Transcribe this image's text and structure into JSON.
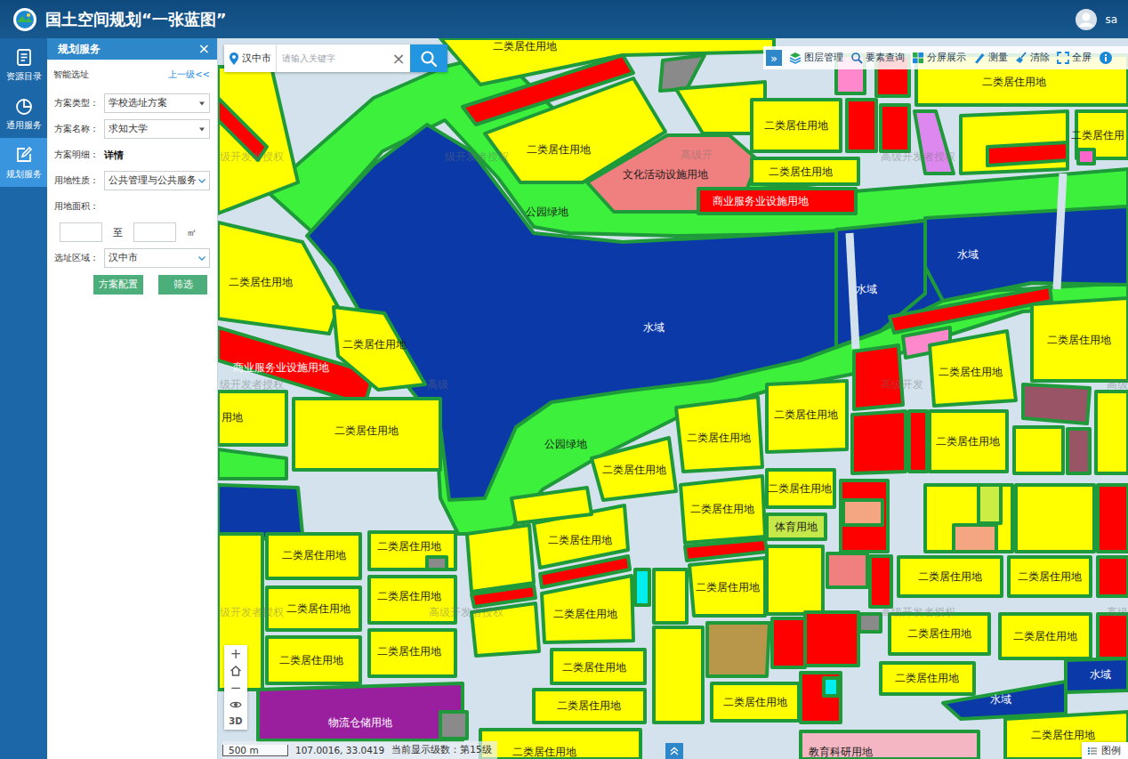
{
  "header": {
    "title": "国土空间规划“一张蓝图”",
    "user": "sa"
  },
  "nav": [
    {
      "label": "资源目录",
      "selected": false
    },
    {
      "label": "通用服务",
      "selected": false
    },
    {
      "label": "规划服务",
      "selected": true
    }
  ],
  "panel": {
    "title": "规划服务",
    "close": "×",
    "subtitle": "智能选址",
    "back": "上一级<<",
    "fields": [
      {
        "label": "方案类型：",
        "value": "学校选址方案",
        "kind": "select"
      },
      {
        "label": "方案名称：",
        "value": "求知大学",
        "kind": "select"
      },
      {
        "label": "方案明细：",
        "value": "详情",
        "kind": "link"
      },
      {
        "label": "用地性质：",
        "value": "公共管理与公共服务",
        "kind": "dropdown"
      }
    ],
    "area": {
      "label": "用地面积：",
      "from": "",
      "to": "",
      "separator": "至",
      "unit": "㎡"
    },
    "region": {
      "label": "选址区域：",
      "value": "汉中市",
      "kind": "dropdown"
    },
    "buttons": [
      "方案配置",
      "筛选"
    ]
  },
  "search": {
    "city": "汉中市",
    "placeholder": "请输入关键字",
    "clear": "×"
  },
  "toolbar": {
    "toggle": "»",
    "tools": [
      "图层管理",
      "要素查询",
      "分屏展示",
      "测量",
      "清除",
      "全屏"
    ]
  },
  "zoom": {
    "zoom_in": "+",
    "zoom_out": "−",
    "mode": "3D"
  },
  "status": {
    "scale": "500 m",
    "coords": "107.0016, 33.0419",
    "level": "当前显示级数：第15级"
  },
  "legend": "图例",
  "watermarks": [
    "级开发者授权",
    "级开发者授权",
    "高级开",
    "高级开发者授权",
    "级开发者授权",
    "高级",
    "高级开发",
    "高级",
    "级开发者授权",
    "高级开发者授权",
    "高级开发者授权",
    "高级"
  ],
  "parcels": [
    {
      "label": "公园绿地",
      "color": "#3cf03c"
    },
    {
      "label": "公园绿地",
      "color": "#3cf03c"
    },
    {
      "label": "水域",
      "color": "#0b3aa8"
    },
    {
      "label": "水域",
      "color": "#0b3aa8"
    },
    {
      "label": "水域",
      "color": "#0b3aa8"
    },
    {
      "label": "",
      "color": "#0b3aa8"
    },
    {
      "label": "",
      "color": "#ffff00"
    },
    {
      "label": "",
      "color": "#ff0000"
    },
    {
      "label": "二类居住用地",
      "color": "#ffff00"
    },
    {
      "label": "商业服务业设施用地",
      "color": "#ff0000"
    },
    {
      "label": "二类居住用地",
      "color": "#ffff00"
    },
    {
      "label": "二类居住用地",
      "color": "#ffff00"
    },
    {
      "label": "用地",
      "color": "#ffff00"
    },
    {
      "label": "",
      "color": "#3cf03c"
    },
    {
      "label": "",
      "color": "#ffff00"
    },
    {
      "label": "二类居住用地",
      "color": "#ffff00"
    },
    {
      "label": "二类居住用地",
      "color": "#ffff00"
    },
    {
      "label": "",
      "color": "#8a8a8a"
    },
    {
      "label": "二类居住用地",
      "color": "#ffff00"
    },
    {
      "label": "二类居住用地",
      "color": "#ffff00"
    },
    {
      "label": "二类居住用地",
      "color": "#ffff00"
    },
    {
      "label": "二类居住用地",
      "color": "#ffff00"
    },
    {
      "label": "物流仓储用地",
      "color": "#9a1f9e"
    },
    {
      "label": "",
      "color": "#8a8a8a"
    },
    {
      "label": "",
      "color": "#ffff00"
    },
    {
      "label": "",
      "color": "#ff0000"
    },
    {
      "label": "",
      "color": "#ffff00"
    },
    {
      "label": "二类居住用地",
      "color": "#ffff00"
    },
    {
      "label": "",
      "color": "#ff0000"
    },
    {
      "label": "二类居住用地",
      "color": "#ffff00"
    },
    {
      "label": "二类居住用地",
      "color": "#ffff00"
    },
    {
      "label": "二类居住用地",
      "color": "#ffff00"
    },
    {
      "label": "",
      "color": "#ffff00"
    },
    {
      "label": "二类居住用地",
      "color": "#ffff00"
    },
    {
      "label": "",
      "color": "#00eeee"
    },
    {
      "label": "",
      "color": "#ffff00"
    },
    {
      "label": "二类居住用地",
      "color": "#ffff00"
    },
    {
      "label": "二类居住用地",
      "color": "#ffff00"
    },
    {
      "label": "",
      "color": "#ff0000"
    },
    {
      "label": "二类居住用地",
      "color": "#ffff00"
    },
    {
      "label": "二类居住用地",
      "color": "#ffff00"
    },
    {
      "label": "二类居住用地",
      "color": "#ffff00"
    },
    {
      "label": "体育用地",
      "color": "#c5e84a"
    },
    {
      "label": "",
      "color": "#ffff00"
    },
    {
      "label": "",
      "color": "#b8964a"
    },
    {
      "label": "",
      "color": "#ff0000"
    },
    {
      "label": "二类居住用地",
      "color": "#ffff00"
    },
    {
      "label": "",
      "color": "#ffff00"
    },
    {
      "label": "",
      "color": "#ff0000"
    },
    {
      "label": "",
      "color": "#ff0000"
    },
    {
      "label": "",
      "color": "#ff0000"
    },
    {
      "label": "",
      "color": "#ff0000"
    },
    {
      "label": "",
      "color": "#f4a582"
    },
    {
      "label": "",
      "color": "#f08080"
    },
    {
      "label": "",
      "color": "#ff0000"
    },
    {
      "label": "",
      "color": "#ff0000"
    },
    {
      "label": "",
      "color": "#8a8a8a"
    },
    {
      "label": "",
      "color": "#ff0000"
    },
    {
      "label": "",
      "color": "#00eeee"
    },
    {
      "label": "",
      "color": "#ff88cc"
    },
    {
      "label": "二类居住用地",
      "color": "#ffff00"
    },
    {
      "label": "",
      "color": "#ff0000"
    },
    {
      "label": "二类居住用地",
      "color": "#ffff00"
    },
    {
      "label": "",
      "color": "#995566"
    },
    {
      "label": "二类居住用地",
      "color": "#ffff00"
    },
    {
      "label": "",
      "color": "#ffff00"
    },
    {
      "label": "",
      "color": "#995566"
    },
    {
      "label": "",
      "color": "#ffff00"
    },
    {
      "label": "",
      "color": "#ffff00"
    },
    {
      "label": "",
      "color": "#ccee44"
    },
    {
      "label": "",
      "color": "#f4a582"
    },
    {
      "label": "",
      "color": "#ffff00"
    },
    {
      "label": "",
      "color": "#ff0000"
    },
    {
      "label": "二类居住用地",
      "color": "#ffff00"
    },
    {
      "label": "二类居住用地",
      "color": "#ffff00"
    },
    {
      "label": "",
      "color": "#ff0000"
    },
    {
      "label": "二类居住用地",
      "color": "#ffff00"
    },
    {
      "label": "二类居住用地",
      "color": "#ffff00"
    },
    {
      "label": "",
      "color": "#ff0000"
    },
    {
      "label": "二类居住用地",
      "color": "#ffff00"
    },
    {
      "label": "水域",
      "color": "#0b3aa8"
    },
    {
      "label": "水域",
      "color": "#0b3aa8"
    },
    {
      "label": "二类居住用地",
      "color": "#ffff00"
    },
    {
      "label": "教育科研用地",
      "color": "#f4b6c2"
    },
    {
      "label": "二类居住用地",
      "color": "#ffff00"
    },
    {
      "label": "二类居住用地",
      "color": "#ffff00"
    },
    {
      "label": "",
      "color": "#ff0000"
    },
    {
      "label": "二类居住用地",
      "color": "#ffff00"
    },
    {
      "label": "",
      "color": "#8a8a8a"
    },
    {
      "label": "",
      "color": "#ffff00"
    },
    {
      "label": "文化活动设施用地",
      "color": "#f08080"
    },
    {
      "label": "二类居住用地",
      "color": "#ffff00"
    },
    {
      "label": "",
      "color": "#ff0000"
    },
    {
      "label": "二类居住用地",
      "color": "#ffff00"
    },
    {
      "label": "商业服务业设施用地",
      "color": "#ff0000"
    },
    {
      "label": "",
      "color": "#ff88cc"
    },
    {
      "label": "",
      "color": "#ff0000"
    },
    {
      "label": "二类居住用地",
      "color": "#ffff00"
    },
    {
      "label": "",
      "color": "#ff0000"
    },
    {
      "label": "",
      "color": "#dd88ee"
    },
    {
      "label": "",
      "color": "#ffff00"
    },
    {
      "label": "二类居住用",
      "color": "#ffff00"
    },
    {
      "label": "",
      "color": "#ff0000"
    },
    {
      "label": "",
      "color": "#ff66cc"
    }
  ]
}
